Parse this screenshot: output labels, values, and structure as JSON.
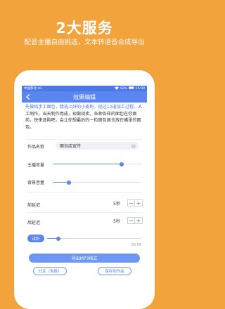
{
  "promo": {
    "title": "2大服务",
    "subtitle": "配音主播自由挑选，文本转语音合成导出"
  },
  "status_bar": {
    "carrier": "中国移动 4G",
    "battery": "92%",
    "time": "15:00"
  },
  "nav": {
    "title": "效果编辑"
  },
  "script_text": {
    "selected": "先做纯手工面包，精选上好的小麦粉，经过12道加工过程。",
    "rest": "人工制作，当天制作而成，现做现卖，各种各样的面包在你面前，快来选购吧，会让你想最后的一粒面包屑也放在嘴里的面包。"
  },
  "work_name": {
    "label": "作品名称",
    "value": "面包店宣传"
  },
  "host_volume": {
    "label": "主播音量",
    "level": 0.78
  },
  "bg_volume": {
    "label": "背景音量",
    "level": 0.18
  },
  "pre_delay": {
    "label": "前延迟",
    "value": "5秒",
    "minus": "−",
    "plus": "+"
  },
  "post_delay": {
    "label": "后延迟",
    "value": "5秒",
    "minus": "−",
    "plus": "+"
  },
  "preview": {
    "label": "试听",
    "time": "00:05",
    "progress": 0.12
  },
  "actions": {
    "export": "导出MP3格式",
    "share": "分享（免费）",
    "save": "保存到作品"
  },
  "colors": {
    "background": "#F2A33C",
    "accent": "#5B86F0"
  }
}
